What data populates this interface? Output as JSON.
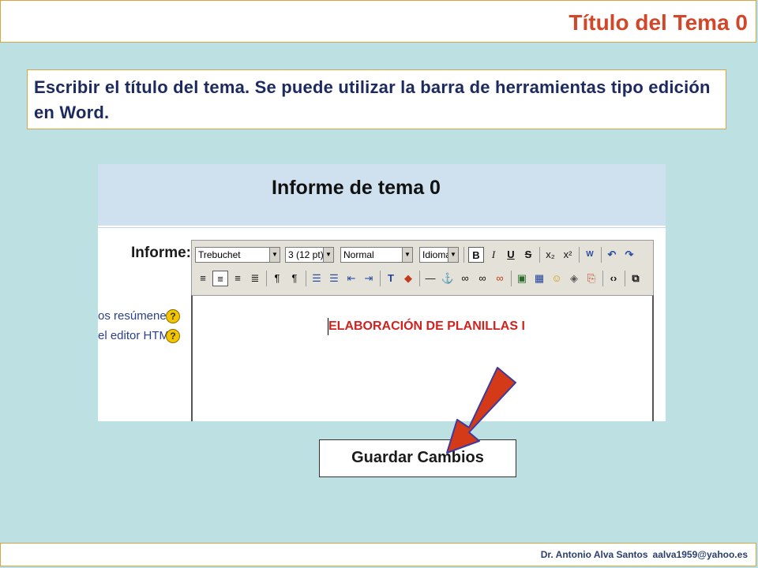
{
  "header": {
    "title": "Título del Tema 0"
  },
  "instruction": "Escribir el título del tema. Se puede utilizar la barra de herramientas tipo edición en Word.",
  "screenshot": {
    "title": "Informe de tema 0",
    "field_label": "Informe:",
    "help_links": [
      "os resúmenes",
      "el editor HTML"
    ],
    "toolbar": {
      "font": "Trebuchet",
      "size": "3 (12 pt)",
      "format": "Normal",
      "language": "Idioma",
      "row1_buttons": [
        "B",
        "I",
        "U",
        "S",
        "x₂",
        "x²",
        "W",
        "↶",
        "↷"
      ],
      "row2_buttons": [
        "align-left",
        "align-center",
        "align-right",
        "justify",
        "ltr",
        "rtl",
        "ordered-list",
        "unordered-list",
        "outdent",
        "indent",
        "text-color",
        "bg-color",
        "hr",
        "anchor",
        "link",
        "unlink",
        "nolink",
        "image",
        "table",
        "smiley",
        "special-char",
        "find-replace",
        "html-source",
        "fullscreen"
      ]
    },
    "editor_content": "ELABORACIÓN DE PLANILLAS I"
  },
  "save_button": {
    "label": "Guardar Cambios"
  },
  "footer": {
    "author": "Dr. Antonio Alva Santos",
    "email": "aalva1959@yahoo.es"
  },
  "colors": {
    "background": "#bde0e3",
    "title": "#d2462a",
    "arrow": "#d43a18",
    "border": "#d9a441"
  }
}
